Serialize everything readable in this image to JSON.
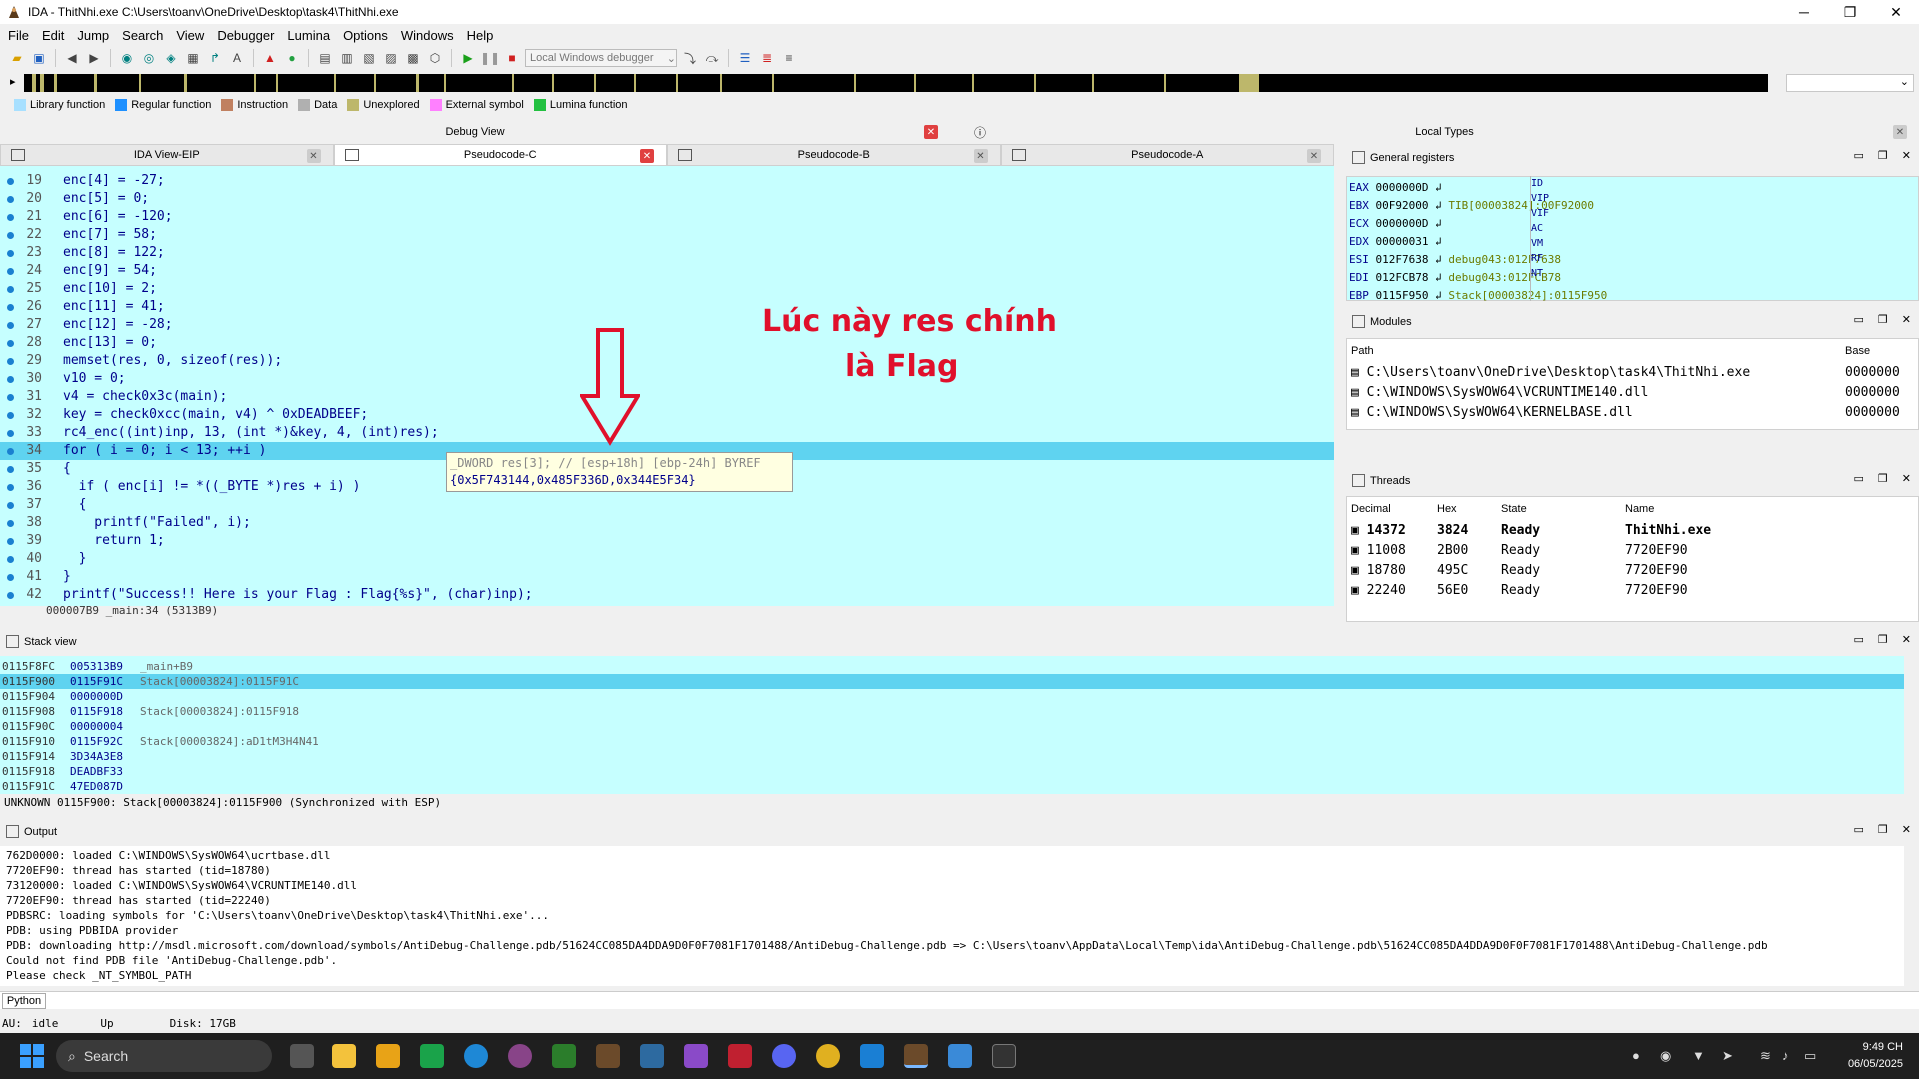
{
  "window": {
    "title": "IDA - ThitNhi.exe C:\\Users\\toanv\\OneDrive\\Desktop\\task4\\ThitNhi.exe"
  },
  "menu": [
    "File",
    "Edit",
    "Jump",
    "Search",
    "View",
    "Debugger",
    "Lumina",
    "Options",
    "Windows",
    "Help"
  ],
  "toolbar": {
    "debugger_select": "Local Windows debugger"
  },
  "legend": [
    {
      "label": "Library function",
      "color": "#a8e0ff"
    },
    {
      "label": "Regular function",
      "color": "#1e90ff"
    },
    {
      "label": "Instruction",
      "color": "#c08060"
    },
    {
      "label": "Data",
      "color": "#b0b0b0"
    },
    {
      "label": "Unexplored",
      "color": "#bdb76b"
    },
    {
      "label": "External symbol",
      "color": "#ff80ff"
    },
    {
      "label": "Lumina function",
      "color": "#22c040"
    }
  ],
  "panels": {
    "debug_view": "Debug View",
    "local_types": "Local Types"
  },
  "tabs": [
    "IDA View-EIP",
    "Pseudocode-C",
    "Pseudocode-B",
    "Pseudocode-A"
  ],
  "code_lines": [
    {
      "ln": "19",
      "text": "enc[4] = -27;"
    },
    {
      "ln": "20",
      "text": "enc[5] = 0;"
    },
    {
      "ln": "21",
      "text": "enc[6] = -120;"
    },
    {
      "ln": "22",
      "text": "enc[7] = 58;"
    },
    {
      "ln": "23",
      "text": "enc[8] = 122;"
    },
    {
      "ln": "24",
      "text": "enc[9] = 54;"
    },
    {
      "ln": "25",
      "text": "enc[10] = 2;"
    },
    {
      "ln": "26",
      "text": "enc[11] = 41;"
    },
    {
      "ln": "27",
      "text": "enc[12] = -28;"
    },
    {
      "ln": "28",
      "text": "enc[13] = 0;"
    },
    {
      "ln": "29",
      "text": "memset(res, 0, sizeof(res));"
    },
    {
      "ln": "30",
      "text": "v10 = 0;"
    },
    {
      "ln": "31",
      "text": "v4 = check0x3c(main);"
    },
    {
      "ln": "32",
      "text": "key = check0xcc(main, v4) ^ 0xDEADBEEF;"
    },
    {
      "ln": "33",
      "text": "rc4_enc((int)inp, 13, (int *)&key, 4, (int)res);"
    },
    {
      "ln": "34",
      "text": "for ( i = 0; i < 13; ++i )"
    },
    {
      "ln": "35",
      "text": "{"
    },
    {
      "ln": "36",
      "text": "  if ( enc[i] != *((_BYTE *)res + i) )"
    },
    {
      "ln": "37",
      "text": "  {"
    },
    {
      "ln": "38",
      "text": "    printf(\"Failed\", i);"
    },
    {
      "ln": "39",
      "text": "    return 1;"
    },
    {
      "ln": "40",
      "text": "  }"
    },
    {
      "ln": "41",
      "text": "}"
    },
    {
      "ln": "42",
      "text": "printf(\"Success!! Here is your Flag : Flag{%s}\", (char)inp);"
    }
  ],
  "code_status": "000007B9 _main:34 (5313B9)",
  "annotation": {
    "line1": "Lúc này res chính",
    "line2": "là Flag"
  },
  "tooltip": {
    "line1": "_DWORD res[3]; // [esp+18h] [ebp-24h] BYREF",
    "line2": "{0x5F743144,0x485F336D,0x344E5F34}"
  },
  "registers": {
    "title": "General registers",
    "rows": [
      {
        "name": "EAX",
        "value": "0000000D",
        "comment": ""
      },
      {
        "name": "EBX",
        "value": "00F92000",
        "comment": "TIB[00003824]:00F92000"
      },
      {
        "name": "ECX",
        "value": "0000000D",
        "comment": ""
      },
      {
        "name": "EDX",
        "value": "00000031",
        "comment": ""
      },
      {
        "name": "ESI",
        "value": "012F7638",
        "comment": "debug043:012F7638"
      },
      {
        "name": "EDI",
        "value": "012FCB78",
        "comment": "debug043:012FCB78"
      },
      {
        "name": "EBP",
        "value": "0115F950",
        "comment": "Stack[00003824]:0115F950"
      }
    ],
    "flags": [
      "ID",
      "VIP",
      "VIF",
      "AC",
      "VM",
      "RF",
      "NT"
    ]
  },
  "modules": {
    "title": "Modules",
    "columns": [
      "Path",
      "Base"
    ],
    "rows": [
      {
        "path": "C:\\Users\\toanv\\OneDrive\\Desktop\\task4\\ThitNhi.exe",
        "base": "0000000"
      },
      {
        "path": "C:\\WINDOWS\\SysWOW64\\VCRUNTIME140.dll",
        "base": "0000000"
      },
      {
        "path": "C:\\WINDOWS\\SysWOW64\\KERNELBASE.dll",
        "base": "0000000"
      }
    ]
  },
  "threads": {
    "title": "Threads",
    "columns": [
      "Decimal",
      "Hex",
      "State",
      "Name"
    ],
    "rows": [
      {
        "dec": "14372",
        "hex": "3824",
        "state": "Ready",
        "name": "ThitNhi.exe"
      },
      {
        "dec": "11008",
        "hex": "2B00",
        "state": "Ready",
        "name": "7720EF90"
      },
      {
        "dec": "18780",
        "hex": "495C",
        "state": "Ready",
        "name": "7720EF90"
      },
      {
        "dec": "22240",
        "hex": "56E0",
        "state": "Ready",
        "name": "7720EF90"
      }
    ]
  },
  "stack": {
    "title": "Stack view",
    "rows": [
      {
        "addr": "0115F8FC",
        "val": "005313B9",
        "cmt": "_main+B9"
      },
      {
        "addr": "0115F900",
        "val": "0115F91C",
        "cmt": "Stack[00003824]:0115F91C"
      },
      {
        "addr": "0115F904",
        "val": "0000000D",
        "cmt": ""
      },
      {
        "addr": "0115F908",
        "val": "0115F918",
        "cmt": "Stack[00003824]:0115F918"
      },
      {
        "addr": "0115F90C",
        "val": "00000004",
        "cmt": ""
      },
      {
        "addr": "0115F910",
        "val": "0115F92C",
        "cmt": "Stack[00003824]:aD1tM3H4N41"
      },
      {
        "addr": "0115F914",
        "val": "3D34A3E8",
        "cmt": ""
      },
      {
        "addr": "0115F918",
        "val": "DEADBF33",
        "cmt": ""
      },
      {
        "addr": "0115F91C",
        "val": "47ED087D",
        "cmt": ""
      }
    ],
    "status": "UNKNOWN 0115F900: Stack[00003824]:0115F900 (Synchronized with ESP)"
  },
  "output": {
    "title": "Output",
    "lines": [
      "762D0000: loaded C:\\WINDOWS\\SysWOW64\\ucrtbase.dll",
      "7720EF90: thread has started (tid=18780)",
      "73120000: loaded C:\\WINDOWS\\SysWOW64\\VCRUNTIME140.dll",
      "7720EF90: thread has started (tid=22240)",
      "PDBSRC: loading symbols for 'C:\\Users\\toanv\\OneDrive\\Desktop\\task4\\ThitNhi.exe'...",
      "PDB: using PDBIDA provider",
      "PDB: downloading http://msdl.microsoft.com/download/symbols/AntiDebug-Challenge.pdb/51624CC085DA4DDA9D0F0F7081F1701488/AntiDebug-Challenge.pdb => C:\\Users\\toanv\\AppData\\Local\\Temp\\ida\\AntiDebug-Challenge.pdb\\51624CC085DA4DDA9D0F0F7081F1701488\\AntiDebug-Challenge.pdb",
      "Could not find PDB file 'AntiDebug-Challenge.pdb'.",
      "Please check _NT_SYMBOL_PATH"
    ]
  },
  "python_label": "Python",
  "statusbar": {
    "au": "AU:",
    "state": "idle",
    "dir": "Up",
    "disk": "Disk: 17GB"
  },
  "taskbar": {
    "search": "Search",
    "time": "9:49 CH",
    "date": "06/05/2025"
  }
}
